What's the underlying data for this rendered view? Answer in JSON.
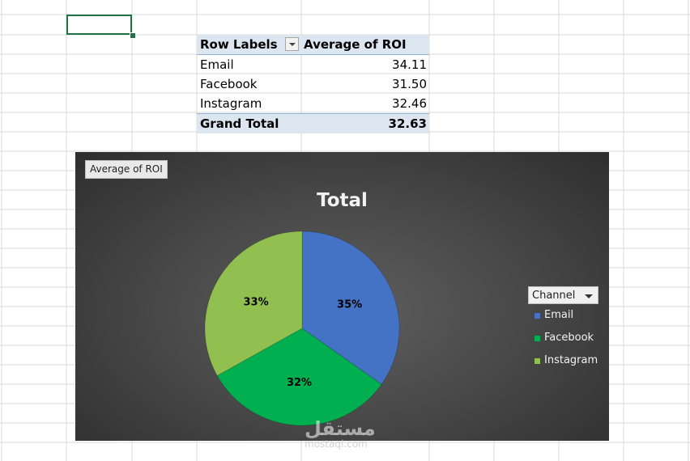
{
  "pivot": {
    "header": {
      "row_labels": "Row Labels",
      "value_header": "Average of ROI"
    },
    "rows": [
      {
        "label": "Email",
        "value": "34.11"
      },
      {
        "label": "Facebook",
        "value": "31.50"
      },
      {
        "label": "Instagram",
        "value": "32.46"
      }
    ],
    "total": {
      "label": "Grand Total",
      "value": "32.63"
    }
  },
  "chart": {
    "field_button": "Average of ROI",
    "legend_field": "Channel"
  },
  "chart_data": {
    "type": "pie",
    "title": "Total",
    "categories": [
      "Email",
      "Facebook",
      "Instagram"
    ],
    "values": [
      34.11,
      31.5,
      32.46
    ],
    "data_labels": [
      "35%",
      "32%",
      "33%"
    ],
    "colors": [
      "#4472c4",
      "#00b050",
      "#92c050"
    ],
    "legend_position": "right"
  },
  "watermark": {
    "arabic": "مستقل",
    "latin": "mostaql.com"
  }
}
